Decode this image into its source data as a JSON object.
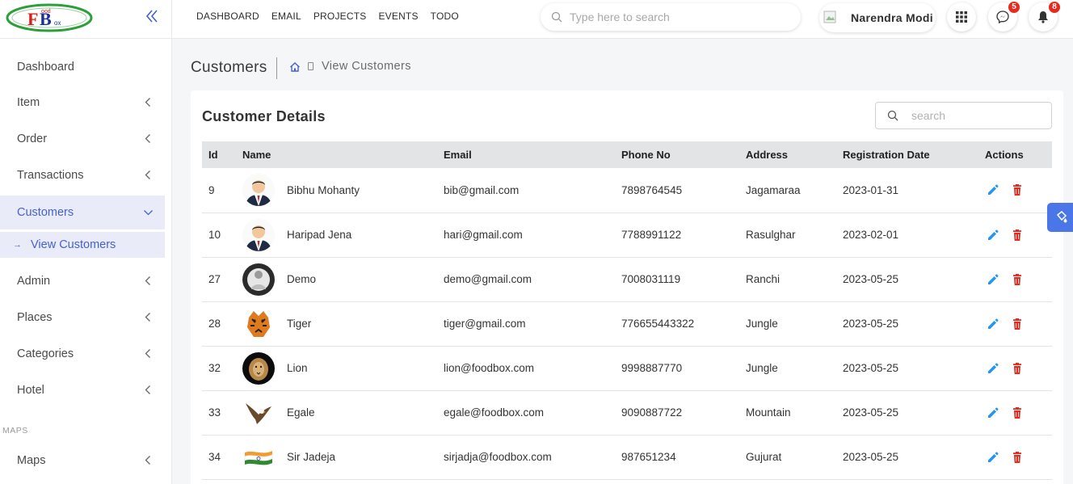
{
  "topnav": {
    "items": [
      "DASHBOARD",
      "EMAIL",
      "PROJECTS",
      "EVENTS",
      "TODO"
    ],
    "search_placeholder": "Type here to search"
  },
  "user": {
    "name": "Narendra Modi"
  },
  "notifications": {
    "messages_count": "5",
    "alerts_count": "8"
  },
  "sidebar": {
    "items": [
      {
        "label": "Dashboard"
      },
      {
        "label": "Item"
      },
      {
        "label": "Order"
      },
      {
        "label": "Transactions"
      },
      {
        "label": "Customers"
      },
      {
        "label": "Admin"
      },
      {
        "label": "Places"
      },
      {
        "label": "Categories"
      },
      {
        "label": "Hotel"
      },
      {
        "label": "Maps"
      }
    ],
    "sub_item": "View Customers",
    "section_maps": "MAPS"
  },
  "page": {
    "title": "Customers",
    "breadcrumb_current": "View Customers"
  },
  "card": {
    "title": "Customer Details",
    "search_placeholder": "search"
  },
  "table": {
    "headers": [
      "Id",
      "Name",
      "Email",
      "Phone No",
      "Address",
      "Registration Date",
      "Actions"
    ],
    "rows": [
      {
        "id": "9",
        "name": "Bibhu Mohanty",
        "email": "bib@gmail.com",
        "phone": "7898764545",
        "address": "Jagamaraa",
        "date": "2023-01-31",
        "avatar": "man-suit"
      },
      {
        "id": "10",
        "name": "Haripad Jena",
        "email": "hari@gmail.com",
        "phone": "7788991122",
        "address": "Rasulghar",
        "date": "2023-02-01",
        "avatar": "man-suit"
      },
      {
        "id": "27",
        "name": "Demo",
        "email": "demo@gmail.com",
        "phone": "7008031119",
        "address": "Ranchi",
        "date": "2023-05-25",
        "avatar": "photo"
      },
      {
        "id": "28",
        "name": "Tiger",
        "email": "tiger@gmail.com",
        "phone": "776655443322",
        "address": "Jungle",
        "date": "2023-05-25",
        "avatar": "tiger"
      },
      {
        "id": "32",
        "name": "Lion",
        "email": "lion@foodbox.com",
        "phone": "9998887770",
        "address": "Jungle",
        "date": "2023-05-25",
        "avatar": "lion"
      },
      {
        "id": "33",
        "name": "Egale",
        "email": "egale@foodbox.com",
        "phone": "9090887722",
        "address": "Mountain",
        "date": "2023-05-25",
        "avatar": "eagle"
      },
      {
        "id": "34",
        "name": "Sir Jadeja",
        "email": "sirjadja@foodbox.com",
        "phone": "987651234",
        "address": "Gujurat",
        "date": "2023-05-25",
        "avatar": "flag"
      }
    ]
  },
  "colors": {
    "accent": "#4561d0",
    "active_bg": "#e9ecf8",
    "edit_icon": "#2196f3",
    "delete_icon": "#e8291c",
    "badge": "#e8291c",
    "float_button": "#4a76e8"
  }
}
